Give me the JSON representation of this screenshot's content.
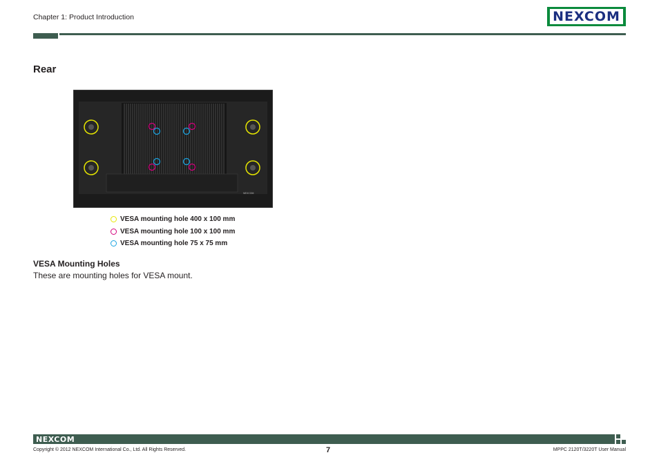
{
  "header": {
    "chapter": "Chapter 1: Product Introduction",
    "logo_text": "NEXCOM"
  },
  "section": {
    "title": "Rear"
  },
  "figure": {
    "case_label": "NEXCOM"
  },
  "legend": [
    {
      "label": "VESA mounting hole 400 x 100 mm",
      "color": "#e6e600"
    },
    {
      "label": "VESA mounting hole 100 x 100 mm",
      "color": "#d4007d"
    },
    {
      "label": "VESA mounting hole 75 x 75 mm",
      "color": "#1aa3e0"
    }
  ],
  "content": {
    "subtitle": "VESA Mounting Holes",
    "description": "These are mounting holes for VESA mount."
  },
  "footer": {
    "logo_text": "NEXCOM",
    "copyright": "Copyright © 2012 NEXCOM International Co., Ltd. All Rights Reserved.",
    "page_number": "7",
    "manual_title": "MPPC 2120T/3220T User Manual"
  },
  "colors": {
    "brand_green": "#0a8a3c",
    "rule": "#3e5d50"
  }
}
